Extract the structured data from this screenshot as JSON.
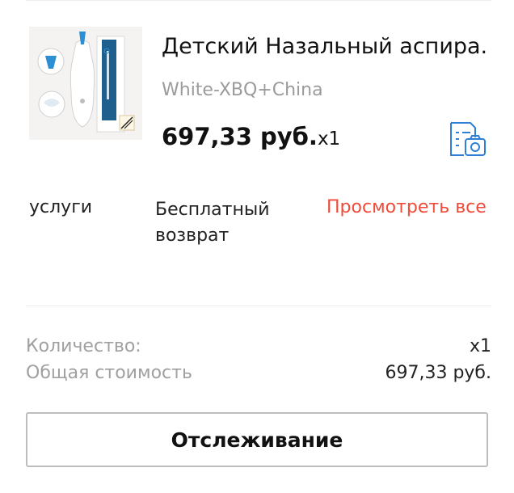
{
  "product": {
    "title": "Детский Назальный аспира...",
    "variant": "White-XBQ+China",
    "price": "697,33 руб.",
    "quantity_suffix": "x1",
    "image_icon": "nasal-aspirator-product-image",
    "review_icon": "photo-review-icon"
  },
  "services": {
    "label": "услуги",
    "free_return": "Бесплатный возврат",
    "view_all": "Просмотреть все"
  },
  "summary": {
    "quantity_label": "Количество:",
    "quantity_value": "x1",
    "total_label": "Общая стоимость",
    "total_value": "697,33 руб."
  },
  "actions": {
    "track_label": "Отслеживание"
  },
  "colors": {
    "accent_link": "#f04a3a",
    "icon_blue": "#2f7fd8",
    "muted_text": "#a0a0a0"
  }
}
